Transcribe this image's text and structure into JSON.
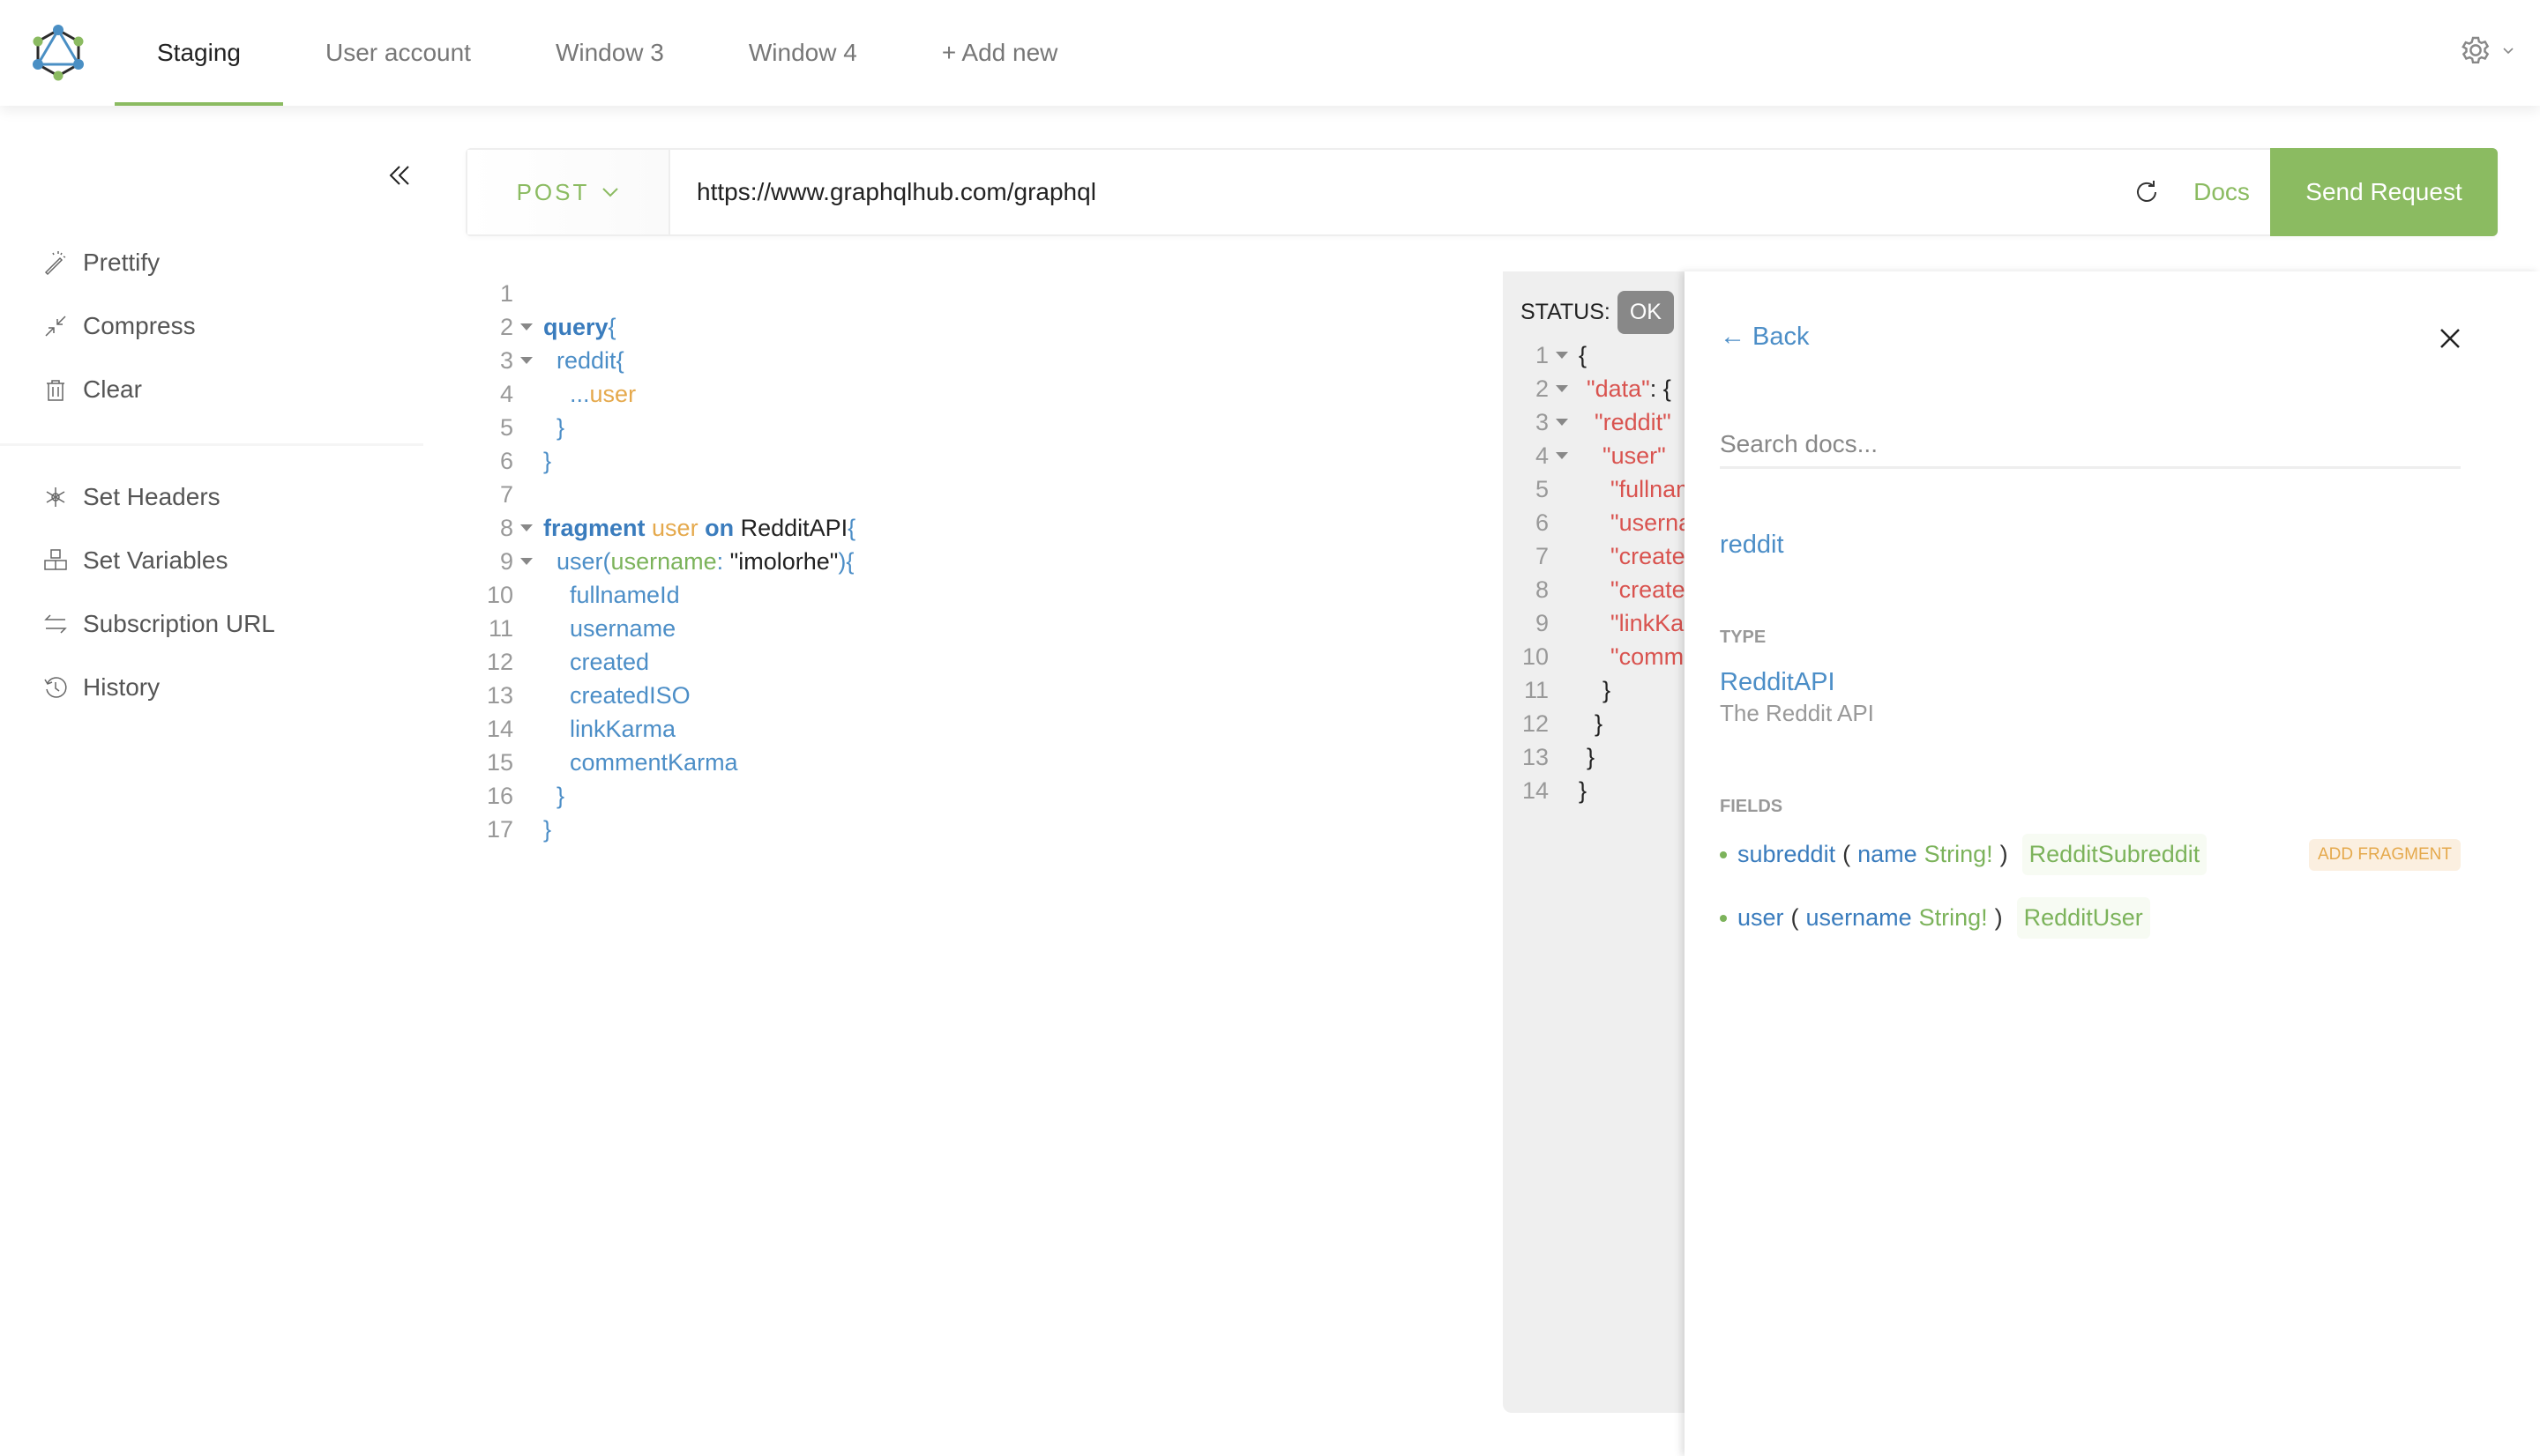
{
  "header": {
    "logo_name": "GraphQL logo",
    "tabs": [
      {
        "label": "Staging",
        "active": true
      },
      {
        "label": "User account",
        "active": false
      },
      {
        "label": "Window 3",
        "active": false
      },
      {
        "label": "Window 4",
        "active": false
      },
      {
        "label": "+ Add new",
        "active": false
      }
    ],
    "settings_icon": "gear-icon"
  },
  "sidebar": {
    "collapse_icon": "double-chevron-left-icon",
    "actions": [
      {
        "label": "Prettify",
        "icon": "magic-wand-icon"
      },
      {
        "label": "Compress",
        "icon": "compress-arrows-icon"
      },
      {
        "label": "Clear",
        "icon": "trash-icon"
      }
    ],
    "settings": [
      {
        "label": "Set Headers",
        "icon": "asterisk-icon"
      },
      {
        "label": "Set Variables",
        "icon": "cubes-icon"
      },
      {
        "label": "Subscription URL",
        "icon": "swap-arrows-icon"
      },
      {
        "label": "History",
        "icon": "history-icon"
      }
    ]
  },
  "request": {
    "method": "POST",
    "url": "https://www.graphqlhub.com/graphql",
    "docs_label": "Docs",
    "send_label": "Send Request"
  },
  "editor": {
    "lines": [
      {
        "n": "1",
        "fold": false
      },
      {
        "n": "2",
        "fold": true
      },
      {
        "n": "3",
        "fold": true
      },
      {
        "n": "4",
        "fold": false
      },
      {
        "n": "5",
        "fold": false
      },
      {
        "n": "6",
        "fold": false
      },
      {
        "n": "7",
        "fold": false
      },
      {
        "n": "8",
        "fold": true
      },
      {
        "n": "9",
        "fold": true
      },
      {
        "n": "10",
        "fold": false
      },
      {
        "n": "11",
        "fold": false
      },
      {
        "n": "12",
        "fold": false
      },
      {
        "n": "13",
        "fold": false
      },
      {
        "n": "14",
        "fold": false
      },
      {
        "n": "15",
        "fold": false
      },
      {
        "n": "16",
        "fold": false
      },
      {
        "n": "17",
        "fold": false
      }
    ],
    "tokens": {
      "query_kw": "query",
      "open_brace": "{",
      "close_brace": "}",
      "reddit_field": "reddit",
      "spread": "...",
      "fragment_ref": "user",
      "fragment_kw": "fragment",
      "fragment_name": "user",
      "on_kw": "on",
      "type_cond": "RedditAPI",
      "user_field": "user",
      "open_paren": "(",
      "arg_name": "username",
      "colon": ": ",
      "arg_value": "\"imolorhe\"",
      "close_paren": ")",
      "fields": [
        "fullnameId",
        "username",
        "created",
        "createdISO",
        "linkKarma",
        "commentKarma"
      ]
    }
  },
  "result": {
    "status_label": "STATUS:",
    "status_value": "OK",
    "lines": [
      {
        "n": "1",
        "fold": true,
        "indent": 0,
        "text": "{",
        "type": "brace"
      },
      {
        "n": "2",
        "fold": true,
        "indent": 1,
        "text": "\"data\"",
        "suffix": ": {",
        "type": "key"
      },
      {
        "n": "3",
        "fold": true,
        "indent": 2,
        "text": "\"reddit\"",
        "suffix": "",
        "type": "key"
      },
      {
        "n": "4",
        "fold": true,
        "indent": 3,
        "text": "\"user\"",
        "suffix": "",
        "type": "key"
      },
      {
        "n": "5",
        "fold": false,
        "indent": 4,
        "text": "\"fullnameId\"",
        "type": "key"
      },
      {
        "n": "6",
        "fold": false,
        "indent": 4,
        "text": "\"username\"",
        "type": "key"
      },
      {
        "n": "7",
        "fold": false,
        "indent": 4,
        "text": "\"created\"",
        "type": "key"
      },
      {
        "n": "8",
        "fold": false,
        "indent": 4,
        "text": "\"createdISO\"",
        "type": "key"
      },
      {
        "n": "9",
        "fold": false,
        "indent": 4,
        "text": "\"linkKarma\"",
        "type": "key"
      },
      {
        "n": "10",
        "fold": false,
        "indent": 4,
        "text": "\"commentKarma\"",
        "type": "key"
      },
      {
        "n": "11",
        "fold": false,
        "indent": 3,
        "text": "}",
        "type": "brace"
      },
      {
        "n": "12",
        "fold": false,
        "indent": 2,
        "text": "}",
        "type": "brace"
      },
      {
        "n": "13",
        "fold": false,
        "indent": 1,
        "text": "}",
        "type": "brace"
      },
      {
        "n": "14",
        "fold": false,
        "indent": 0,
        "text": "}",
        "type": "brace"
      }
    ]
  },
  "docs": {
    "back_label": "← Back",
    "search_placeholder": "Search docs...",
    "title": "reddit",
    "type_section": "TYPE",
    "type_name": "RedditAPI",
    "type_description": "The Reddit API",
    "fields_section": "FIELDS",
    "fields": [
      {
        "name": "subreddit",
        "arg_name": "name",
        "arg_type": "String!",
        "return_type": "RedditSubreddit",
        "add_fragment": "ADD FRAGMENT"
      },
      {
        "name": "user",
        "arg_name": "username",
        "arg_type": "String!",
        "return_type": "RedditUser"
      }
    ]
  }
}
